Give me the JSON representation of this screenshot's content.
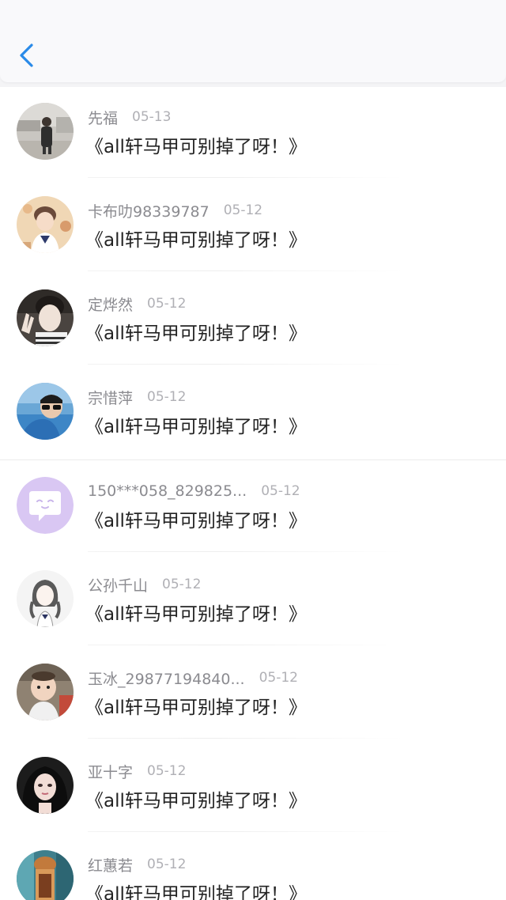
{
  "header": {
    "back_icon": "chevron-left-icon",
    "accent_color": "#2a8ae8"
  },
  "messages": [
    {
      "name": "先福",
      "date": "05-13",
      "text": "《all轩马甲可别掉了呀！》",
      "avatar": "photo-person-outdoor"
    },
    {
      "name": "卡布叻98339787",
      "date": "05-12",
      "text": "《all轩马甲可别掉了呀！》",
      "avatar": "photo-anime-boy"
    },
    {
      "name": "定烨然",
      "date": "05-12",
      "text": "《all轩马甲可别掉了呀！》",
      "avatar": "photo-person-peace"
    },
    {
      "name": "宗惜萍",
      "date": "05-12",
      "text": "《all轩马甲可别掉了呀！》",
      "avatar": "photo-person-sunglasses"
    },
    {
      "name": "150***058_829825...",
      "date": "05-12",
      "text": "《all轩马甲可别掉了呀！》",
      "avatar": "default-chat-bubble-icon"
    },
    {
      "name": "公孙千山",
      "date": "05-12",
      "text": "《all轩马甲可别掉了呀！》",
      "avatar": "illustration-girl"
    },
    {
      "name": "玉冰_29877194840...",
      "date": "05-12",
      "text": "《all轩马甲可别掉了呀！》",
      "avatar": "photo-baby"
    },
    {
      "name": "亚十字",
      "date": "05-12",
      "text": "《all轩马甲可别掉了呀！》",
      "avatar": "photo-person-dark-hair"
    },
    {
      "name": "红蕙若",
      "date": "05-12",
      "text": "《all轩马甲可别掉了呀！》",
      "avatar": "illustration-colorful"
    }
  ]
}
